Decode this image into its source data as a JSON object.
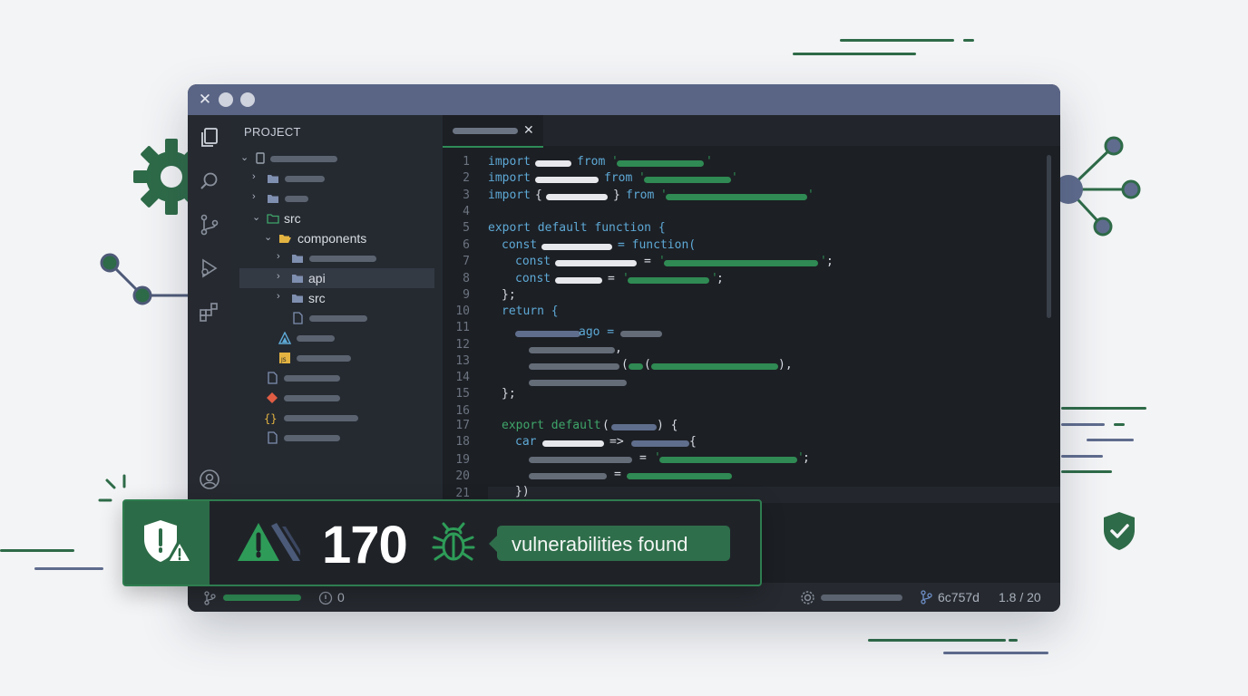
{
  "sidebar": {
    "title": "PROJECT",
    "items": [
      {
        "label": "src"
      },
      {
        "label": "components"
      },
      {
        "label": "api"
      },
      {
        "label": "src"
      }
    ]
  },
  "code": {
    "line_numbers": [
      "1",
      "2",
      "3",
      "4",
      "5",
      "6",
      "7",
      "8",
      "9",
      "10",
      "11",
      "12",
      "13",
      "14",
      "15",
      "16",
      "17",
      "18",
      "19",
      "20",
      "21"
    ],
    "tokens": {
      "import": "import",
      "from": "from",
      "quote": "'",
      "brace_open": "{",
      "brace_close": "}",
      "export_default_function": "export default function {",
      "const": "const",
      "eq_function": "= function(",
      "eq": "=",
      "semicolon": ";",
      "close_paren": "};",
      "return": "return {",
      "ago": "ago =",
      "comma": ",",
      "paren_open": "(",
      "paren_close_comma": "),",
      "close_brace": "};",
      "export_default": "export default",
      "export_default_end": ") {",
      "car": "car",
      "arrow": "=>",
      "brace": "{",
      "end_paren": "})"
    }
  },
  "statusbar": {
    "problems": "0",
    "commit": "6c757d",
    "position": "1.8 / 20"
  },
  "alert": {
    "count": "170",
    "message": "vulnerabilities found"
  },
  "colors": {
    "accent_green": "#2e6b48",
    "titlebar": "#5a6585",
    "editor_bg": "#1c1f24"
  }
}
